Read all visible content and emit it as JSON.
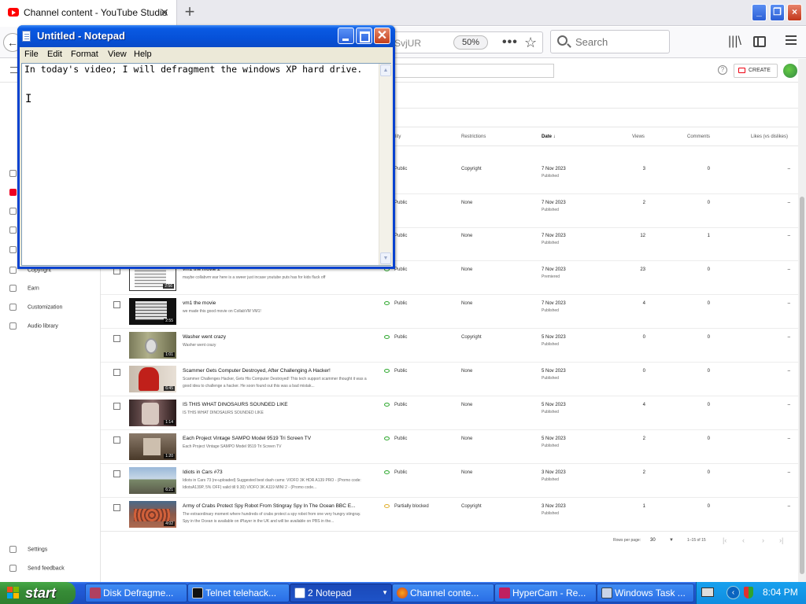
{
  "browser": {
    "tab_title": "Channel content - YouTube Studio",
    "url_fragment": "SvjUR",
    "zoom": "50%",
    "search_placeholder": "Search"
  },
  "studio": {
    "create_label": "CREATE",
    "sidebar": [
      "Copyright",
      "Earn",
      "Customization",
      "Audio library",
      "Settings",
      "Send feedback"
    ],
    "columns": {
      "visibility": "lity",
      "restrictions": "Restrictions",
      "date": "Date",
      "views": "Views",
      "comments": "Comments",
      "likes": "Likes (vs dislikes)"
    },
    "rows": [
      {
        "title": "",
        "desc": "",
        "duration": "",
        "visibility": "Public",
        "restrictions": "Copyright",
        "date": "7 Nov 2023",
        "status": "Published",
        "views": "3",
        "comments": "0",
        "likes": "–"
      },
      {
        "title": "",
        "desc": "",
        "duration": "",
        "visibility": "Public",
        "restrictions": "None",
        "date": "7 Nov 2023",
        "status": "Published",
        "views": "2",
        "comments": "0",
        "likes": "–"
      },
      {
        "title": "",
        "desc": "",
        "duration": "",
        "visibility": "Public",
        "restrictions": "None",
        "date": "7 Nov 2023",
        "status": "Published",
        "views": "12",
        "comments": "1",
        "likes": "–"
      },
      {
        "title": "vm1 the movie 2",
        "desc": "maybe collabvm war here is a sweer just incase youtube puts has for kids fluck off",
        "duration": "2:56",
        "visibility": "Public",
        "restrictions": "None",
        "date": "7 Nov 2023",
        "status": "Premiered",
        "views": "23",
        "comments": "0",
        "likes": "–"
      },
      {
        "title": "vm1 the movie",
        "desc": "we made this good movie on CollabVM VM1!",
        "duration": "2:55",
        "visibility": "Public",
        "restrictions": "None",
        "date": "7 Nov 2023",
        "status": "Published",
        "views": "4",
        "comments": "0",
        "likes": "–"
      },
      {
        "title": "Washer went crazy",
        "desc": "Washer went crazy",
        "duration": "1:01",
        "visibility": "Public",
        "restrictions": "Copyright",
        "date": "5 Nov 2023",
        "status": "Published",
        "views": "0",
        "comments": "0",
        "likes": "–"
      },
      {
        "title": "Scammer Gets Computer Destroyed, After Challenging A Hacker!",
        "desc": "Scammer Challenges Hacker, Gets His Computer Destroyed! This tech support scammer thought it was a good idea to challenge a hacker. He soon found out this was a bad mistak...",
        "duration": "6:45",
        "visibility": "Public",
        "restrictions": "None",
        "date": "5 Nov 2023",
        "status": "Published",
        "views": "0",
        "comments": "0",
        "likes": "–"
      },
      {
        "title": "IS THIS WHAT DINOSAURS SOUNDED LIKE",
        "desc": "IS THIS WHAT DINOSAURS SOUNDED LIKE",
        "duration": "1:14",
        "visibility": "Public",
        "restrictions": "None",
        "date": "5 Nov 2023",
        "status": "Published",
        "views": "4",
        "comments": "0",
        "likes": "–"
      },
      {
        "title": "Each Project Vintage SAMPO Model 9519 Tri Screen TV",
        "desc": "Each Project Vintage SAMPO Model 9519 Tri Screen TV",
        "duration": "1:20",
        "visibility": "Public",
        "restrictions": "None",
        "date": "5 Nov 2023",
        "status": "Published",
        "views": "2",
        "comments": "0",
        "likes": "–"
      },
      {
        "title": "Idiots in Cars #73",
        "desc": "Idiots in Cars 73 (re-uploaded) Suggested best dash cams: VIOFO 3K HDR A139 PRO - (Promo code: IdiotsA139P, 5% OFF) valid till 9.30) VIOFO 3K A119 MINI 2 - (Promo code...",
        "duration": "6:21",
        "visibility": "Public",
        "restrictions": "None",
        "date": "3 Nov 2023",
        "status": "Published",
        "views": "2",
        "comments": "0",
        "likes": "–"
      },
      {
        "title": "Army of Crabs Protect Spy Robot From Stingray Spy In The Ocean BBC E...",
        "desc": "The extraordinary moment where hundreds of crabs protect a spy robot from one very hungry stingray. Spy in the Ocean is available on iPlayer in the UK and will be available on PBS in the...",
        "duration": "4:02",
        "visibility": "Partially blocked",
        "restrictions": "Copyright",
        "date": "3 Nov 2023",
        "status": "Published",
        "views": "1",
        "comments": "0",
        "likes": "–"
      }
    ],
    "pager": {
      "rows_per_page_label": "Rows per page:",
      "rows_per_page": "30",
      "range": "1–15 of 15"
    }
  },
  "notepad": {
    "title": "Untitled - Notepad",
    "menu": [
      "File",
      "Edit",
      "Format",
      "View",
      "Help"
    ],
    "content": "In today's video; I will defragment the windows XP hard drive."
  },
  "taskbar": {
    "start_label": "start",
    "tasks": [
      "Disk Defragme...",
      "Telnet telehack...",
      "2 Notepad",
      "Channel conte...",
      "HyperCam - Re...",
      "Windows Task ..."
    ],
    "clock": "8:04 PM"
  },
  "colors": {
    "xp_blue": "#0a5ae3",
    "xp_green": "#378c37",
    "youtube_red": "#ff0000"
  }
}
